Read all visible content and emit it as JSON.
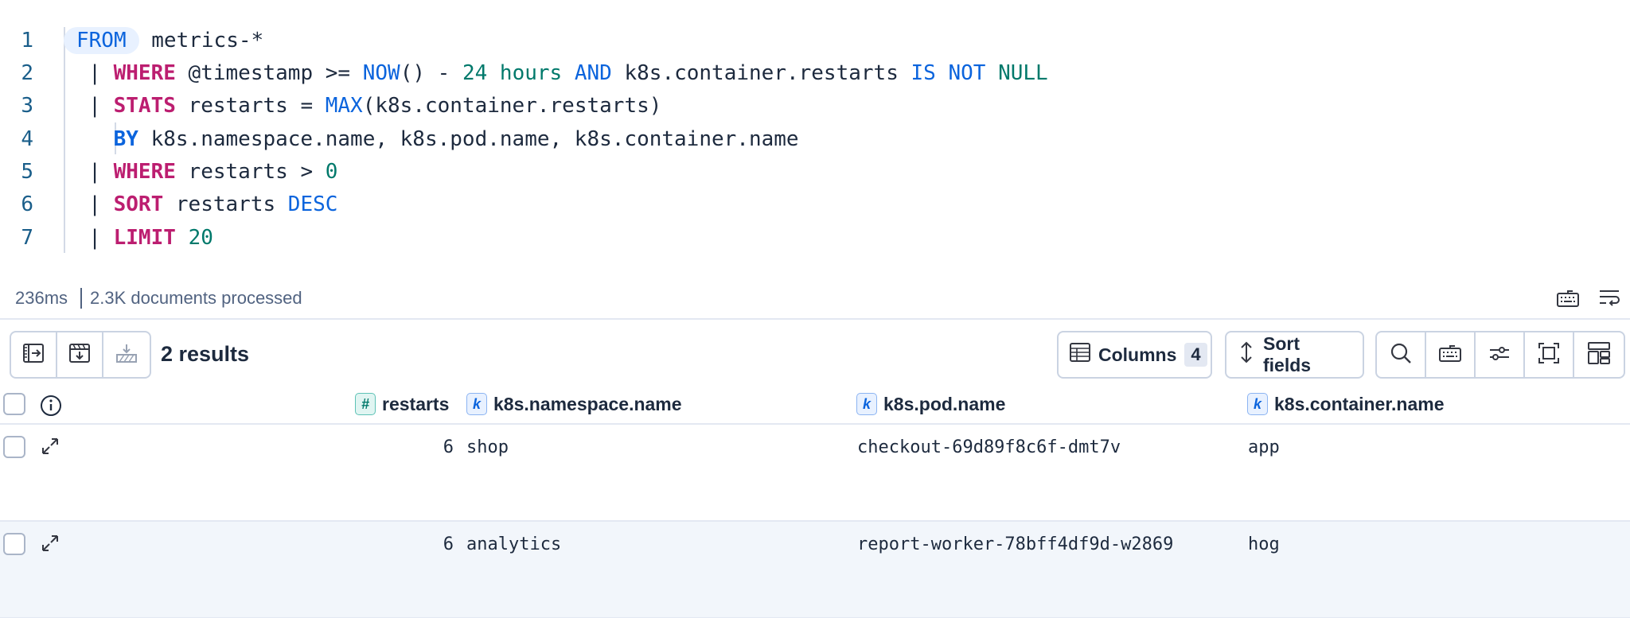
{
  "editor": {
    "lines": [
      {
        "n": "1",
        "tokens": [
          {
            "t": "FROM",
            "c": "from"
          },
          {
            "t": " metrics-*",
            "c": "plain"
          }
        ]
      },
      {
        "n": "2",
        "tokens": [
          {
            "t": "  | ",
            "c": "pipe"
          },
          {
            "t": "WHERE",
            "c": "pink"
          },
          {
            "t": " @timestamp >= ",
            "c": "plain"
          },
          {
            "t": "NOW",
            "c": "blue"
          },
          {
            "t": "() - ",
            "c": "plain"
          },
          {
            "t": "24 hours",
            "c": "green"
          },
          {
            "t": " ",
            "c": "plain"
          },
          {
            "t": "AND",
            "c": "blue"
          },
          {
            "t": " k8s.container.restarts ",
            "c": "plain"
          },
          {
            "t": "IS NOT",
            "c": "blue"
          },
          {
            "t": " ",
            "c": "plain"
          },
          {
            "t": "NULL",
            "c": "green"
          }
        ]
      },
      {
        "n": "3",
        "tokens": [
          {
            "t": "  | ",
            "c": "pipe"
          },
          {
            "t": "STATS",
            "c": "pink"
          },
          {
            "t": " restarts = ",
            "c": "plain"
          },
          {
            "t": "MAX",
            "c": "blue"
          },
          {
            "t": "(k8s.container.restarts)",
            "c": "plain"
          }
        ]
      },
      {
        "n": "4",
        "tokens": [
          {
            "t": "    ",
            "c": "plain"
          },
          {
            "t": "BY",
            "c": "by"
          },
          {
            "t": " k8s.namespace.name, k8s.pod.name, k8s.container.name",
            "c": "plain"
          }
        ]
      },
      {
        "n": "5",
        "tokens": [
          {
            "t": "  | ",
            "c": "pipe"
          },
          {
            "t": "WHERE",
            "c": "pink"
          },
          {
            "t": " restarts > ",
            "c": "plain"
          },
          {
            "t": "0",
            "c": "green"
          }
        ]
      },
      {
        "n": "6",
        "tokens": [
          {
            "t": "  | ",
            "c": "pipe"
          },
          {
            "t": "SORT",
            "c": "pink"
          },
          {
            "t": " restarts ",
            "c": "plain"
          },
          {
            "t": "DESC",
            "c": "blue"
          }
        ]
      },
      {
        "n": "7",
        "tokens": [
          {
            "t": "  | ",
            "c": "pipe"
          },
          {
            "t": "LIMIT",
            "c": "pink"
          },
          {
            "t": " ",
            "c": "plain"
          },
          {
            "t": "20",
            "c": "green"
          }
        ]
      }
    ]
  },
  "status": {
    "time": "236ms",
    "docs": "2.3K documents processed",
    "right_icons": [
      "keyboard-icon",
      "wrap-icon"
    ]
  },
  "toolbar": {
    "left_icons": [
      "expand-panel-icon",
      "download-icon",
      "save-icon"
    ],
    "results_label": "2 results",
    "columns_label": "Columns",
    "columns_count": "4",
    "sort_label": "Sort fields",
    "right_icons": [
      "search-icon",
      "keyboard-icon",
      "settings-sliders-icon",
      "fullscreen-icon",
      "layout-icon"
    ]
  },
  "table": {
    "columns": [
      {
        "label": "restarts",
        "type": "#"
      },
      {
        "label": "k8s.namespace.name",
        "type": "k"
      },
      {
        "label": "k8s.pod.name",
        "type": "k"
      },
      {
        "label": "k8s.container.name",
        "type": "k"
      }
    ],
    "rows": [
      {
        "restarts": "6",
        "namespace": "shop",
        "pod": "checkout-69d89f8c6f-dmt7v",
        "container": "app"
      },
      {
        "restarts": "6",
        "namespace": "analytics",
        "pod": "report-worker-78bff4df9d-w2869",
        "container": "hog"
      }
    ]
  },
  "colors": {
    "keyword_pink": "#bc1e70",
    "keyword_blue": "#0b64dd",
    "literal_green": "#00796b",
    "line_number": "#1a5e8a"
  }
}
